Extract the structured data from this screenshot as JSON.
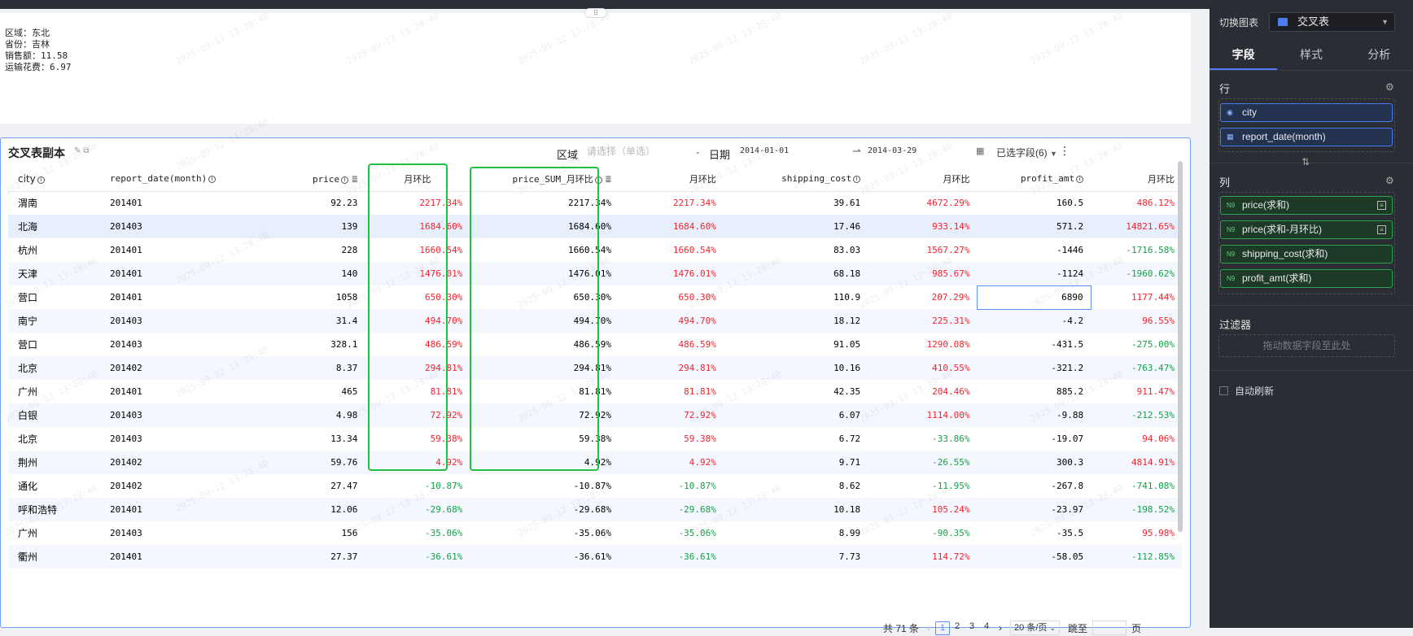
{
  "info_lines": [
    "区域：东北",
    "省份：吉林",
    "销售额：11.58",
    "运输花费：6.97"
  ],
  "table": {
    "title": "交叉表副本",
    "filters": {
      "region_label": "区域",
      "region_placeholder": "请选择（单选）",
      "date_label": "日期",
      "date_start": "2014-01-01",
      "date_end": "2014-03-29",
      "chosen_fields": "已选字段(6)"
    },
    "columns": [
      "city",
      "report_date(month)",
      "price",
      "月环比",
      "price_SUM_月环比",
      "月环比",
      "shipping_cost",
      "月环比",
      "profit_amt",
      "月环比"
    ],
    "rows": [
      [
        "渭南",
        "201401",
        "92.23",
        "2217.34%",
        "2217.34%",
        "2217.34%",
        "39.61",
        "4672.29%",
        "160.5",
        "486.12%"
      ],
      [
        "北海",
        "201403",
        "139",
        "1684.60%",
        "1684.60%",
        "1684.60%",
        "17.46",
        "933.14%",
        "571.2",
        "14821.65%"
      ],
      [
        "杭州",
        "201401",
        "228",
        "1660.54%",
        "1660.54%",
        "1660.54%",
        "83.03",
        "1567.27%",
        "-1446",
        "-1716.58%"
      ],
      [
        "天津",
        "201401",
        "140",
        "1476.01%",
        "1476.01%",
        "1476.01%",
        "68.18",
        "985.67%",
        "-1124",
        "-1960.62%"
      ],
      [
        "营口",
        "201401",
        "1058",
        "650.30%",
        "650.30%",
        "650.30%",
        "110.9",
        "207.29%",
        "6890",
        "1177.44%"
      ],
      [
        "南宁",
        "201403",
        "31.4",
        "494.70%",
        "494.70%",
        "494.70%",
        "18.12",
        "225.31%",
        "-4.2",
        "96.55%"
      ],
      [
        "营口",
        "201403",
        "328.1",
        "486.59%",
        "486.59%",
        "486.59%",
        "91.05",
        "1290.08%",
        "-431.5",
        "-275.00%"
      ],
      [
        "北京",
        "201402",
        "8.37",
        "294.81%",
        "294.81%",
        "294.81%",
        "10.16",
        "410.55%",
        "-321.2",
        "-763.47%"
      ],
      [
        "广州",
        "201401",
        "465",
        "81.81%",
        "81.81%",
        "81.81%",
        "42.35",
        "204.46%",
        "885.2",
        "911.47%"
      ],
      [
        "白银",
        "201403",
        "4.98",
        "72.92%",
        "72.92%",
        "72.92%",
        "6.07",
        "1114.00%",
        "-9.88",
        "-212.53%"
      ],
      [
        "北京",
        "201403",
        "13.34",
        "59.38%",
        "59.38%",
        "59.38%",
        "6.72",
        "-33.86%",
        "-19.07",
        "94.06%"
      ],
      [
        "荆州",
        "201402",
        "59.76",
        "4.92%",
        "4.92%",
        "4.92%",
        "9.71",
        "-26.55%",
        "300.3",
        "4814.91%"
      ],
      [
        "通化",
        "201402",
        "27.47",
        "-10.87%",
        "-10.87%",
        "-10.87%",
        "8.62",
        "-11.95%",
        "-267.8",
        "-741.08%"
      ],
      [
        "呼和浩特",
        "201401",
        "12.06",
        "-29.68%",
        "-29.68%",
        "-29.68%",
        "10.18",
        "105.24%",
        "-23.97",
        "-198.52%"
      ],
      [
        "广州",
        "201403",
        "156",
        "-35.06%",
        "-35.06%",
        "-35.06%",
        "8.99",
        "-90.35%",
        "-35.5",
        "95.98%"
      ],
      [
        "衢州",
        "201401",
        "27.37",
        "-36.61%",
        "-36.61%",
        "-36.61%",
        "7.73",
        "114.72%",
        "-58.05",
        "-112.85%"
      ]
    ],
    "pagination": {
      "total": "共 71 条",
      "pages": [
        "1",
        "2",
        "3",
        "4"
      ],
      "current": "1",
      "page_size": "20 条/页",
      "jump_label": "跳至",
      "page_suffix": "页"
    }
  },
  "panel": {
    "switch_label": "切换图表",
    "chart_type": "交叉表",
    "tabs": [
      "字段",
      "样式",
      "分析"
    ],
    "active_tab": "字段",
    "rows_title": "行",
    "row_fields": [
      "city",
      "report_date(month)"
    ],
    "cols_title": "列",
    "col_fields": [
      "price(求和)",
      "price(求和-月环比)",
      "shipping_cost(求和)",
      "profit_amt(求和)"
    ],
    "measure_tag": "N9",
    "filter_title": "过滤器",
    "filter_hint": "拖动数据字段至此处",
    "auto_refresh": "自动刷新"
  },
  "watermark": "2025-09-12 13:28:40",
  "colors": {
    "positive": "#f5222d",
    "negative": "#13a24a",
    "accent": "#4d7cf0",
    "highlight_box": "#21c244"
  }
}
